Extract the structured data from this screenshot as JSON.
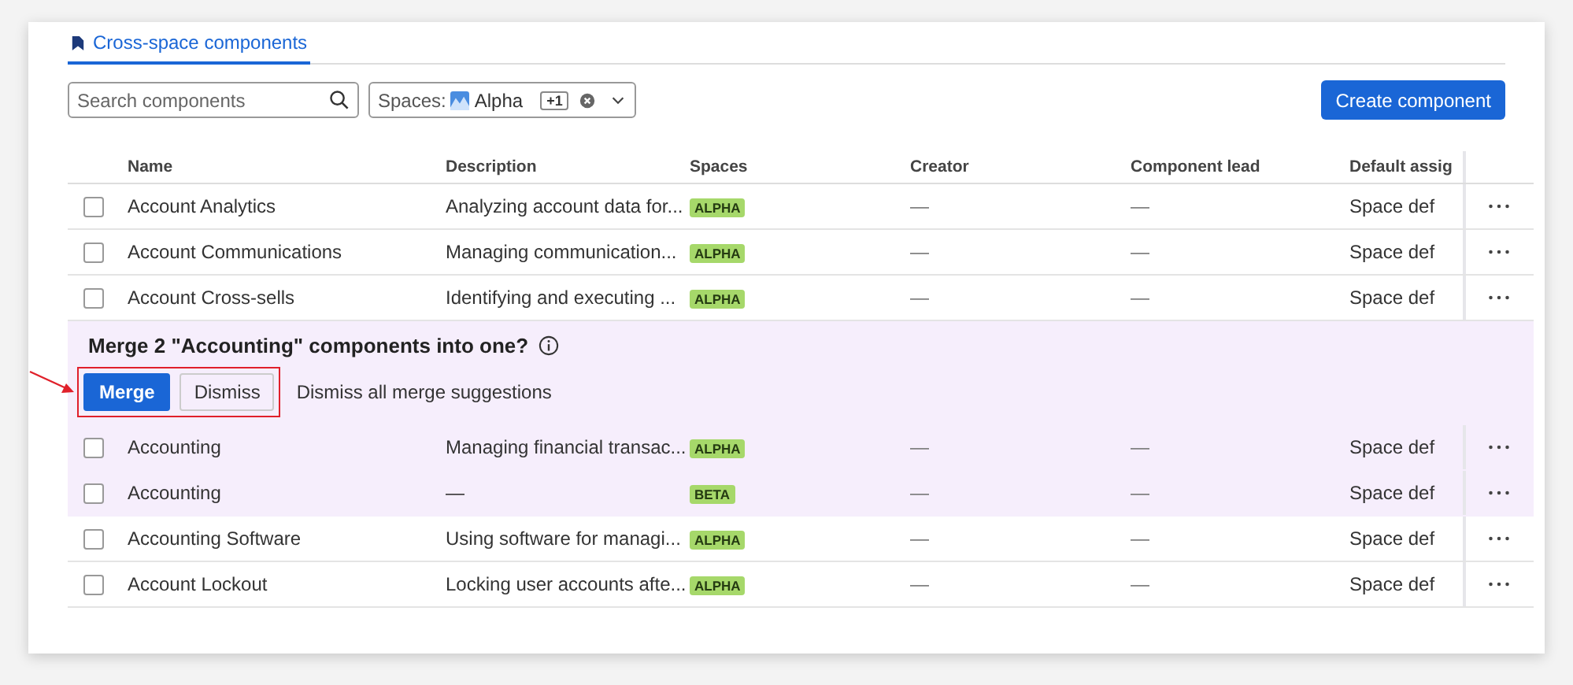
{
  "tab": {
    "label": "Cross-space components",
    "selected": true
  },
  "toolbar": {
    "search": {
      "placeholder": "Search components"
    },
    "spaces_filter": {
      "label": "Spaces:",
      "value": "Alpha",
      "extra_count": "+1"
    },
    "create_button": "Create component"
  },
  "table": {
    "columns": [
      "Name",
      "Description",
      "Spaces",
      "Creator",
      "Component lead",
      "Default assig"
    ],
    "rows_before": [
      {
        "name": "Account Analytics",
        "description": "Analyzing account data for...",
        "space": "ALPHA",
        "creator": "—",
        "lead": "—",
        "assignee": "Space def",
        "checked": false
      },
      {
        "name": "Account Communications",
        "description": "Managing communication...",
        "space": "ALPHA",
        "creator": "—",
        "lead": "—",
        "assignee": "Space def",
        "checked": false
      },
      {
        "name": "Account Cross-sells",
        "description": "Identifying and executing ...",
        "space": "ALPHA",
        "creator": "—",
        "lead": "—",
        "assignee": "Space def",
        "checked": false
      }
    ],
    "merge_suggestion": {
      "title": "Merge 2 \"Accounting\" components into one?",
      "merge_button": "Merge",
      "dismiss_button": "Dismiss",
      "dismiss_all_link": "Dismiss all merge suggestions",
      "highlighted": true,
      "rows": [
        {
          "name": "Accounting",
          "description": "Managing financial transac...",
          "space": "ALPHA",
          "creator": "—",
          "lead": "—",
          "assignee": "Space def",
          "checked": false
        },
        {
          "name": "Accounting",
          "description": "—",
          "space": "BETA",
          "creator": "—",
          "lead": "—",
          "assignee": "Space def",
          "checked": false
        }
      ]
    },
    "rows_after": [
      {
        "name": "Accounting Software",
        "description": "Using software for managi...",
        "space": "ALPHA",
        "creator": "—",
        "lead": "—",
        "assignee": "Space def",
        "checked": false
      },
      {
        "name": "Account Lockout",
        "description": "Locking user accounts afte...",
        "space": "ALPHA",
        "creator": "—",
        "lead": "—",
        "assignee": "Space def",
        "checked": false
      }
    ]
  }
}
